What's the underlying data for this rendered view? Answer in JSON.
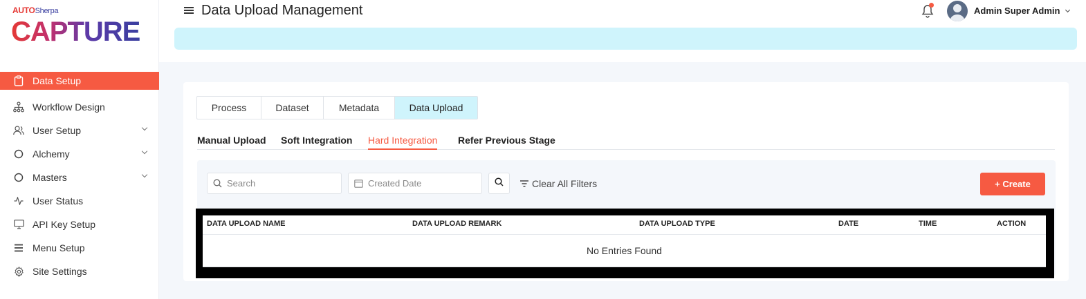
{
  "logo": {
    "auto": "AUTO",
    "sherpa": "Sherpa",
    "main": "CAPTURE"
  },
  "sidebar": {
    "items": [
      {
        "label": "Data Setup",
        "icon": "clipboard-icon",
        "active": true
      },
      {
        "label": "Workflow Design",
        "icon": "hierarchy-icon"
      },
      {
        "label": "User Setup",
        "icon": "users-icon",
        "has_submenu": true
      },
      {
        "label": "Alchemy",
        "icon": "circle-icon",
        "has_submenu": true
      },
      {
        "label": "Masters",
        "icon": "circle-icon",
        "has_submenu": true
      },
      {
        "label": "User Status",
        "icon": "activity-icon"
      },
      {
        "label": "API Key Setup",
        "icon": "monitor-icon"
      },
      {
        "label": "Menu Setup",
        "icon": "list-icon"
      },
      {
        "label": "Site Settings",
        "icon": "gear-icon"
      }
    ]
  },
  "header": {
    "title": "Data Upload Management",
    "user_name": "Admin Super Admin"
  },
  "tabs": [
    {
      "label": "Process"
    },
    {
      "label": "Dataset"
    },
    {
      "label": "Metadata"
    },
    {
      "label": "Data Upload",
      "active": true
    }
  ],
  "subtabs": [
    {
      "label": "Manual Upload"
    },
    {
      "label": "Soft Integration"
    },
    {
      "label": "Hard Integration",
      "active": true
    },
    {
      "label": "Refer Previous Stage"
    }
  ],
  "filters": {
    "search_placeholder": "Search",
    "date_placeholder": "Created Date",
    "clear_label": "Clear All Filters",
    "create_label": "+ Create"
  },
  "table": {
    "columns": [
      "DATA UPLOAD NAME",
      "DATA UPLOAD REMARK",
      "DATA UPLOAD TYPE",
      "DATE",
      "TIME",
      "ACTION"
    ],
    "empty_text": "No Entries Found"
  },
  "colors": {
    "accent": "#f65a42",
    "banner": "#cff4fc"
  }
}
